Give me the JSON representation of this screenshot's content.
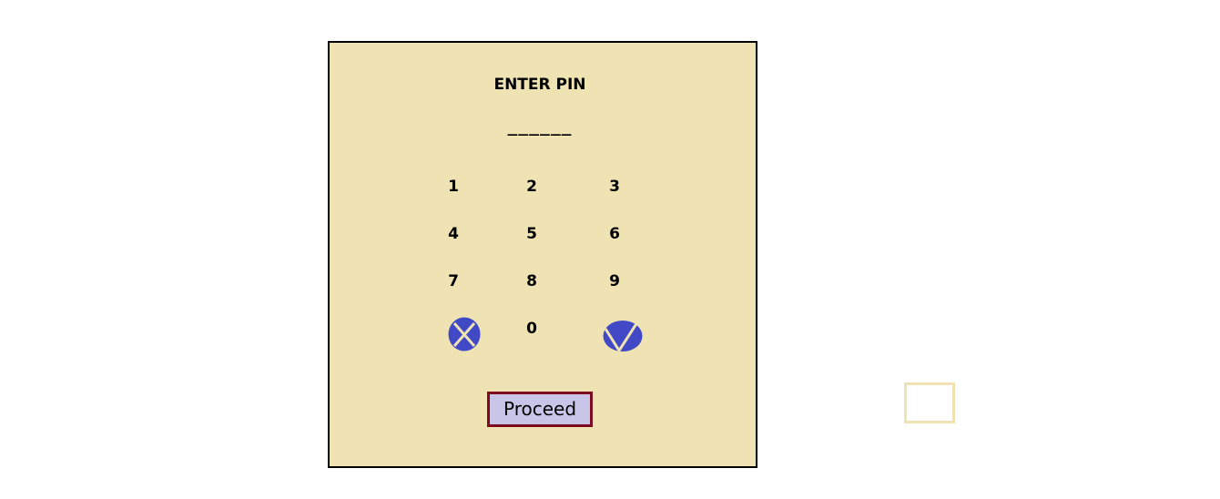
{
  "pin_screen": {
    "title": "ENTER PIN",
    "pin_display": "______",
    "keys": [
      "1",
      "2",
      "3",
      "4",
      "5",
      "6",
      "7",
      "8",
      "9",
      "0"
    ],
    "cancel_icon": "x-circle-icon",
    "confirm_icon": "check-circle-icon",
    "proceed_label": "Proceed"
  },
  "colors": {
    "panel_background": "#efe3b4",
    "icon_blue": "#4249c6",
    "proceed_background": "#c9c5e8",
    "proceed_border": "#7d0d1e"
  }
}
